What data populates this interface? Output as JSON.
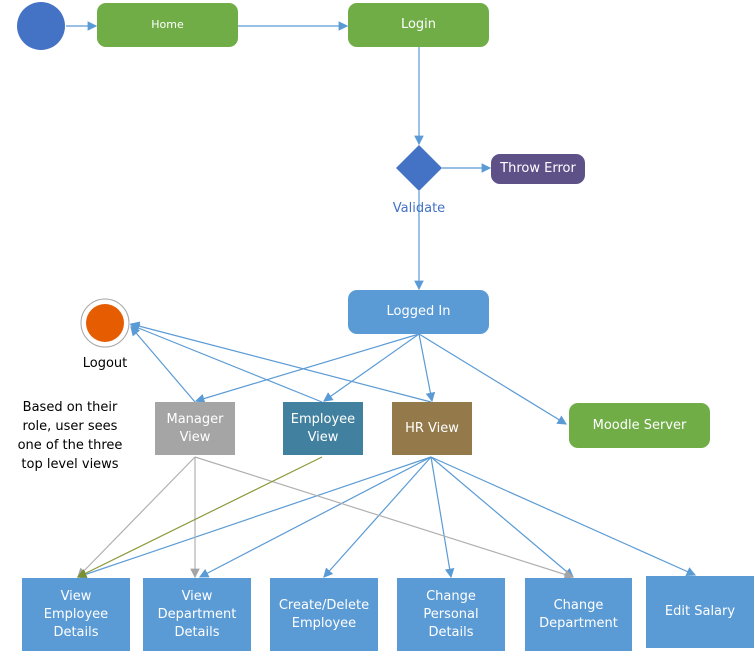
{
  "nodes": {
    "home": "Home",
    "login": "Login",
    "validate": "Validate",
    "throw_error": "Throw Error",
    "logged_in": "Logged In",
    "logout": "Logout",
    "manager_view": "Manager View",
    "employee_view": "Employee View",
    "hr_view": "HR View",
    "moodle_server": "Moodle Server",
    "view_employee_details": "View Employee Details",
    "view_department_details": "View Department Details",
    "create_delete_employee": "Create/Delete Employee",
    "change_personal_details": "Change Personal Details",
    "change_department": "Change Department",
    "edit_salary": "Edit Salary"
  },
  "note": "Based on their role, user sees one of the three top level views",
  "colors": {
    "green": "#70ad47",
    "blue": "#5b9bd5",
    "dark_blue": "#4472c4",
    "purple": "#5e5188",
    "gray": "#a5a5a5",
    "teal": "#41809e",
    "brown": "#94794b",
    "orange": "#e65c00",
    "olive": "#8c9a3c"
  }
}
